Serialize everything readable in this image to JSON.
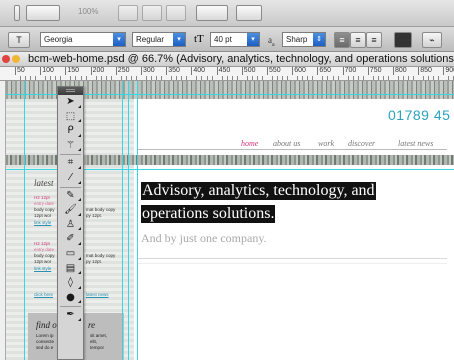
{
  "app": {
    "zoom_label": "100%",
    "accent_color": "#2aa2bf",
    "guide_color": "#35d7e4",
    "pink_color": "#d8337c"
  },
  "options_bar": {
    "font_family": "Georgia",
    "font_style": "Regular",
    "font_size": "40 pt",
    "aa_label": "a",
    "antialias": "Sharp",
    "icons": [
      "text-orientation-icon",
      "align-left-icon",
      "align-center-icon",
      "align-right-icon",
      "text-color-swatch",
      "warp-text-icon"
    ]
  },
  "document": {
    "tab_title": "bcm-web-home.psd @ 66.7% (Advisory, analytics, technology, and operations solutions"
  },
  "ruler": {
    "labels": [
      "50",
      "100",
      "150",
      "200",
      "250",
      "300",
      "350",
      "400",
      "450",
      "500",
      "550",
      "600",
      "650",
      "700",
      "750",
      "800",
      "850",
      "900"
    ]
  },
  "page": {
    "phone": "01789 45",
    "nav": [
      {
        "label": "home",
        "active": true
      },
      {
        "label": "about us",
        "active": false
      },
      {
        "label": "work",
        "active": false
      },
      {
        "label": "discover",
        "active": false
      },
      {
        "label": "latest news",
        "active": false
      }
    ],
    "headline_line1": "Advisory, analytics, technology, and",
    "headline_line2": "operations solutions.",
    "subline": "And by just one company."
  },
  "sidebar": {
    "latest_title": "latest",
    "item1_heading": "H2 12pt",
    "item1_sub": "entry date",
    "item1_body_l1": "body copy",
    "item1_body_l2": "12pt wor",
    "item1_link": "link style",
    "item1_body_r1": "mat body copy",
    "item1_body_r2": "py 12pt.",
    "item2_heading": "H2 12pt",
    "item2_sub": "entry date",
    "item2_body_l1": "body copy",
    "item2_body_l2": "12pt wor",
    "item2_link": "link style",
    "item2_body_r1": "mat body copy",
    "item2_body_r2": "py 12pt.",
    "click_link_l": "click here",
    "click_link_r": "latest news",
    "find_title_l": "find o",
    "find_title_r": "re",
    "find_l1": "Lorem ip",
    "find_l2": "consecte",
    "find_l3": "sed do e",
    "find_r1": "sit amet,",
    "find_r2": "elit,",
    "find_r3": "tempor"
  },
  "tools": [
    {
      "name": "move-tool-icon",
      "glyph": "➤",
      "active": false,
      "sep_after": false
    },
    {
      "name": "marquee-tool-icon",
      "glyph": "⬚",
      "active": false,
      "sep_after": false
    },
    {
      "name": "lasso-tool-icon",
      "glyph": "ᑭ",
      "active": false,
      "sep_after": false
    },
    {
      "name": "magic-wand-tool-icon",
      "glyph": "⚚",
      "active": false,
      "sep_after": true
    },
    {
      "name": "crop-tool-icon",
      "glyph": "⌗",
      "active": false,
      "sep_after": false
    },
    {
      "name": "eyedropper-tool-icon",
      "glyph": "⁄",
      "active": false,
      "sep_after": true
    },
    {
      "name": "healing-brush-tool-icon",
      "glyph": "✎",
      "active": false,
      "sep_after": false
    },
    {
      "name": "brush-tool-icon",
      "glyph": "🖌",
      "active": false,
      "sep_after": false
    },
    {
      "name": "clone-stamp-tool-icon",
      "glyph": "♙",
      "active": false,
      "sep_after": false
    },
    {
      "name": "history-brush-tool-icon",
      "glyph": "✐",
      "active": false,
      "sep_after": false
    },
    {
      "name": "eraser-tool-icon",
      "glyph": "▭",
      "active": false,
      "sep_after": false
    },
    {
      "name": "gradient-tool-icon",
      "glyph": "▤",
      "active": false,
      "sep_after": false
    },
    {
      "name": "blur-tool-icon",
      "glyph": "◊",
      "active": false,
      "sep_after": false
    },
    {
      "name": "dodge-tool-icon",
      "glyph": "●",
      "active": false,
      "sep_after": true
    },
    {
      "name": "pen-tool-icon",
      "glyph": "✒",
      "active": false,
      "sep_after": false
    }
  ]
}
